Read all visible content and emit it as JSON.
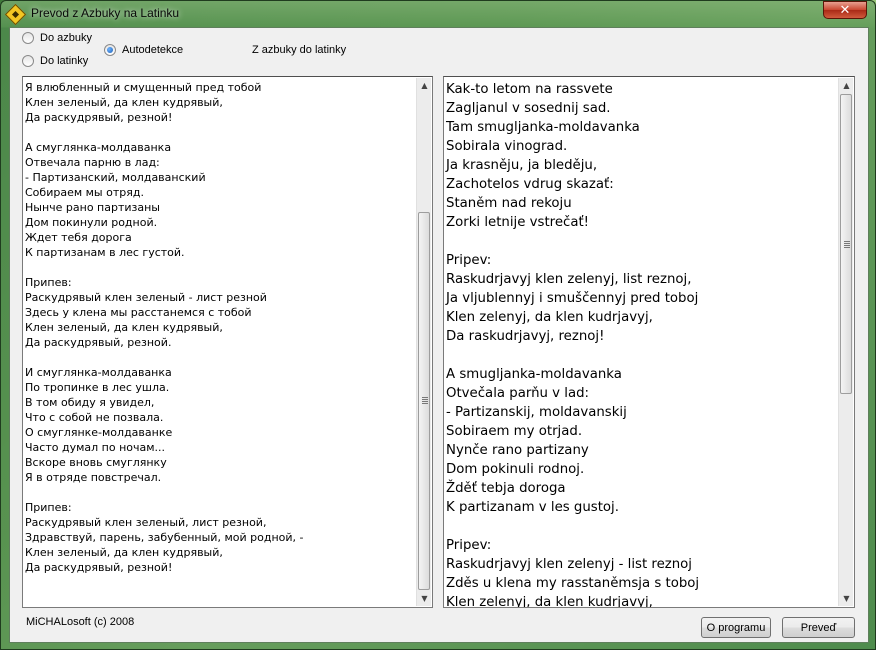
{
  "window": {
    "title": "Prevod z Azbuky na Latinku",
    "close_label": "✕"
  },
  "options": {
    "to_cyrillic": "Do azbuky",
    "to_latin": "Do latinky",
    "autodetect": "Autodetekce",
    "selected": "autodetect"
  },
  "status_label": "Z azbuky do latinky",
  "left_text": [
    "Я влюбленный и смущенный пред тобой",
    "Клен зеленый, да клен кудрявый,",
    "Да раскудрявый, резной!",
    "",
    "А смуглянка-молдаванка",
    "Отвечала парню в лад:",
    "- Партизанский, молдаванский",
    "Собираем мы отряд.",
    "Нынче рано партизаны",
    "Дом покинули родной.",
    "Ждет тебя дорога",
    "К партизанам в лес густой.",
    "",
    "Припев:",
    "Раскудрявый клен зеленый - лист резной",
    "Здесь у клена мы расстанемся с тобой",
    "Клен зеленый, да клен кудрявый,",
    "Да раскудрявый, резной.",
    "",
    "И смуглянка-молдаванка",
    "По тропинке в лес ушла.",
    "В том обиду я увидел,",
    "Что с собой не позвала.",
    "О смуглянке-молдаванке",
    "Часто думал по ночам...",
    "Вскоре вновь смуглянку",
    "Я в отряде повстречал.",
    "",
    "Припев:",
    "Раскудрявый клен зеленый, лист резной,",
    "Здравствуй, парень, забубенный, мой родной, -",
    "Клен зеленый, да клен кудрявый,",
    "Да раскудрявый, резной!"
  ],
  "right_text": [
    "Kak-to letom na rassvete",
    "Zagljanul v sosednij sad.",
    "Tam smugljanka-moldavanka",
    "Sobirala vinograd.",
    "Ja krasněju, ja bleděju,",
    "Zachotelos vdrug skazať:",
    "Staněm nad rekoju",
    "Zorki letnije vstrečať!",
    "",
    "Pripev:",
    "Raskudrjavyj klen zelenyj, list reznoj,",
    "Ja vljublennyj i smuščennyj pred toboj",
    "Klen zelenyj, da klen kudrjavyj,",
    "Da raskudrjavyj, reznoj!",
    "",
    "A smugljanka-moldavanka",
    "Otvečala parňu v lad:",
    "- Partizanskij, moldavanskij",
    "Sobiraem my otrjad.",
    "Nynče rano partizany",
    "Dom pokinuli rodnoj.",
    "Žděť tebja doroga",
    "K partizanam v les gustoj.",
    "",
    "Pripev:",
    "Raskudrjavyj klen zelenyj - list reznoj",
    "Zděs u klena my rasstaněmsja s toboj",
    "Klen zelenyj, da klen kudrjavyj,"
  ],
  "footer": {
    "copyright": "MiCHALosoft (c) 2008",
    "about_button": "O programu",
    "convert_button": "Preveď"
  },
  "icons": {
    "app": "diamond-app-icon",
    "close": "close-icon",
    "scroll_up": "scroll-up-arrow-icon",
    "scroll_down": "scroll-down-arrow-icon"
  }
}
